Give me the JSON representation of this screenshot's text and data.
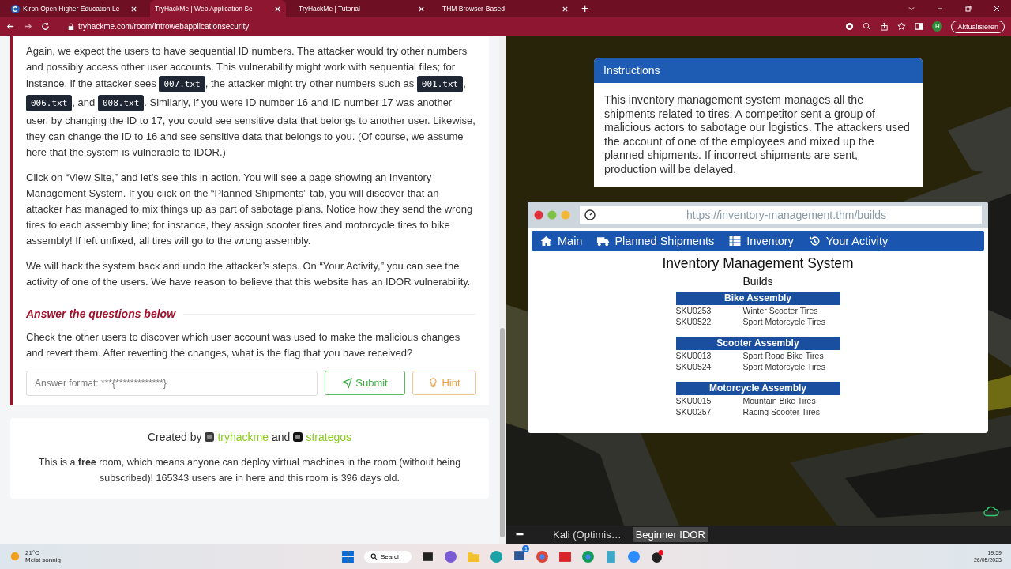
{
  "browser": {
    "tabs": [
      {
        "title": "Kiron Open Higher Education Le",
        "selected": false
      },
      {
        "title": "TryHackMe | Web Application Se",
        "selected": true
      },
      {
        "title": "TryHackMe | Tutorial",
        "selected": false
      },
      {
        "title": "THM Browser-Based",
        "selected": false
      }
    ],
    "new_tab": "+",
    "url": "tryhackme.com/room/introwebapplicationsecurity",
    "profile": "H",
    "update_button": "Aktualisieren"
  },
  "room": {
    "paragraphs": [
      [
        {
          "kind": "text",
          "text": "Again, we expect the users to have sequential ID numbers. The attacker would try other numbers and possibly access other user accounts. This vulnerability might work with sequential files; for instance, if the attacker sees "
        },
        {
          "kind": "code",
          "text": "007.txt"
        },
        {
          "kind": "text",
          "text": ", the attacker might try other numbers such as "
        },
        {
          "kind": "code",
          "text": "001.txt"
        },
        {
          "kind": "text",
          "text": ", "
        },
        {
          "kind": "code",
          "text": "006.txt"
        },
        {
          "kind": "text",
          "text": ", and "
        },
        {
          "kind": "code",
          "text": "008.txt"
        },
        {
          "kind": "text",
          "text": ". Similarly, if you were ID number 16 and ID number 17 was another user, by changing the ID to 17, you could see sensitive data that belongs to another user. Likewise, they can change the ID to 16 and see sensitive data that belongs to you. (Of course, we assume here that the system is vulnerable to IDOR.)"
        }
      ],
      [
        {
          "kind": "text",
          "text": "Click on “View Site,” and let’s see this in action. You will see a page showing an Inventory Management System. If you click on the “Planned Shipments” tab, you will discover that an attacker has managed to mix things up as part of sabotage plans. Notice how they send the wrong tires to each assembly line; for instance, they assign scooter tires and motorcycle tires to bike assembly! If left unfixed, all tires will go to the wrong assembly."
        }
      ],
      [
        {
          "kind": "text",
          "text": "We will hack the system back and undo the attacker’s steps. On “Your Activity,” you can see the activity of one of the users. We have reason to believe that this website has an IDOR vulnerability."
        }
      ]
    ],
    "questions_heading": "Answer the questions below",
    "question": "Check the other users to discover which user account was used to make the malicious changes and revert them. After reverting the changes, what is the flag that you have received?",
    "answer": {
      "placeholder": "Answer format: ***{*************}"
    },
    "submit": "Submit",
    "hint": "Hint",
    "footer": {
      "created_by": "Created by",
      "joiner": "and",
      "authors": [
        {
          "name": "tryhackme"
        },
        {
          "name": "strategos"
        }
      ],
      "note": "This is a **free** room, which means anyone can deploy virtual machines in the room (without being subscribed)! 165343 users are in here and this room is 396 days old."
    }
  },
  "vm": {
    "instructions": {
      "title": "Instructions",
      "text": "This inventory management system manages all the shipments related to tires. A competitor sent a group of malicious actors to sabotage our logistics. The attackers used the account of one of the employees and mixed up the planned shipments. If incorrect shipments are sent, production will be delayed."
    },
    "site": {
      "url": "https://inventory-management.thm/builds",
      "nav": [
        {
          "label": "Main"
        },
        {
          "label": "Planned Shipments"
        },
        {
          "label": "Inventory"
        },
        {
          "label": "Your Activity"
        }
      ],
      "title": "Inventory Management System",
      "subtitle": "Builds",
      "groups": [
        {
          "name": "Bike Assembly",
          "items": [
            {
              "sku": "SKU0253",
              "name": "Winter Scooter Tires"
            },
            {
              "sku": "SKU0522",
              "name": "Sport Motorcycle Tires"
            }
          ]
        },
        {
          "name": "Scooter Assembly",
          "items": [
            {
              "sku": "SKU0013",
              "name": "Sport Road Bike Tires"
            },
            {
              "sku": "SKU0524",
              "name": "Sport Motorcycle Tires"
            }
          ]
        },
        {
          "name": "Motorcycle Assembly",
          "items": [
            {
              "sku": "SKU0015",
              "name": "Mountain Bike Tires"
            },
            {
              "sku": "SKU0257",
              "name": "Racing Scooter Tires"
            }
          ]
        }
      ]
    },
    "windows": [
      {
        "label": "Kali (Optimis…",
        "selected": false
      },
      {
        "label": "Beginner IDOR",
        "selected": true
      }
    ]
  },
  "taskbar": {
    "temperature": "21°C",
    "weather": "Meist sonnig",
    "search": "Search",
    "badge": "1",
    "time": "19:59",
    "date": "26/05/2023"
  }
}
